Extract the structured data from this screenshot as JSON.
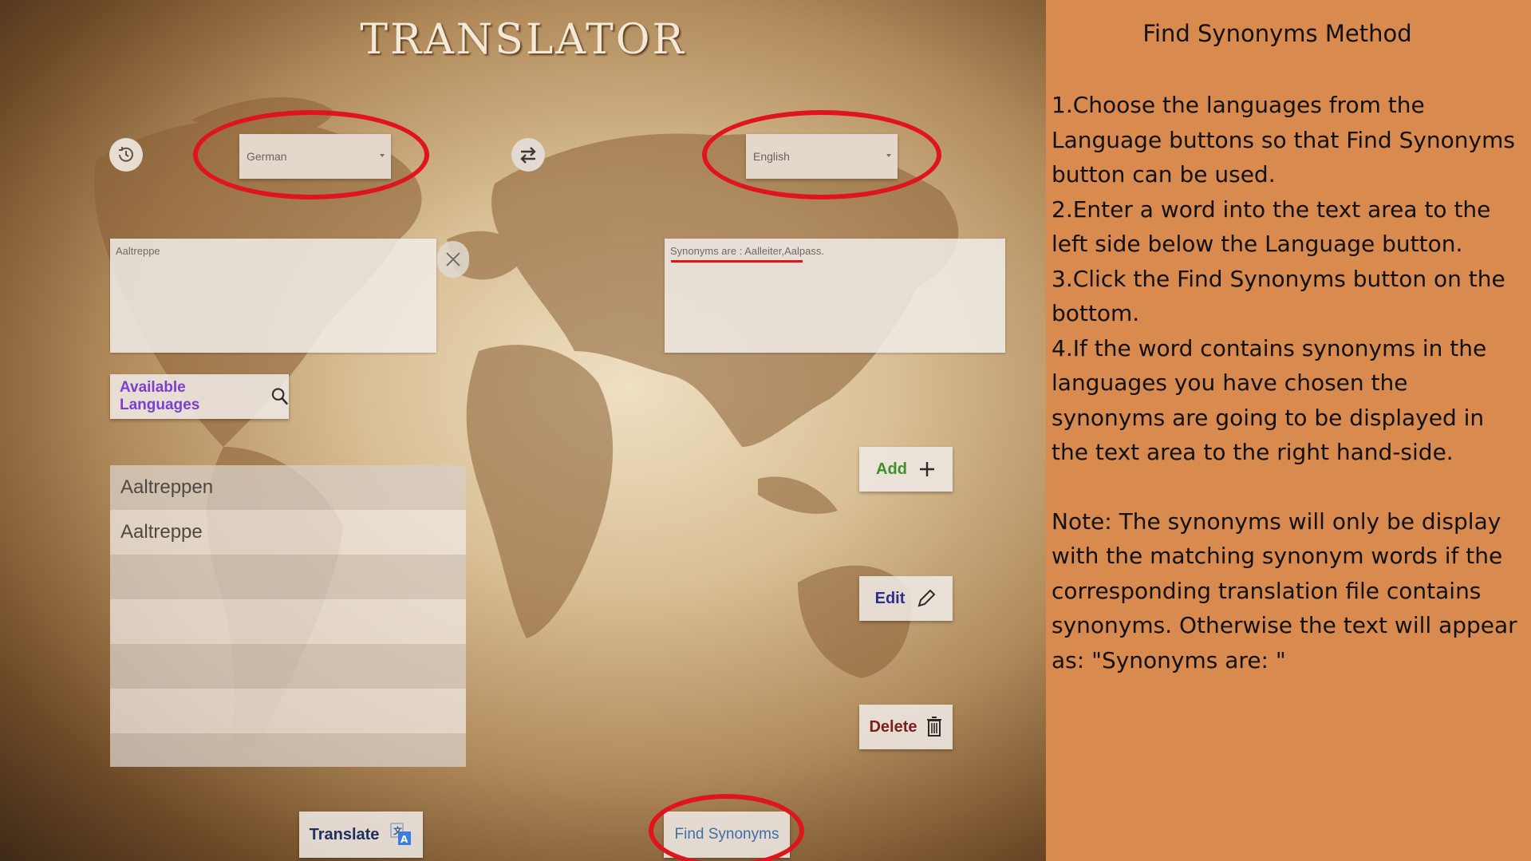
{
  "app": {
    "title": "TRANSLATOR",
    "source_language": "German",
    "target_language": "English",
    "input_text": "Aaltreppe",
    "output_text": "Synonyms are : Aalleiter,Aalpass.",
    "available_languages_label": "Available Languages",
    "word_list": [
      "Aaltreppen",
      "Aaltreppe",
      "",
      "",
      "",
      "",
      ""
    ],
    "add_label": "Add",
    "edit_label": "Edit",
    "delete_label": "Delete",
    "translate_label": "Translate",
    "find_synonyms_label": "Find Synonyms"
  },
  "panel": {
    "title": "Find Synonyms Method",
    "steps": [
      "1.Choose the languages from the Language buttons so that Find Synonyms button can be used.",
      "2.Enter a word into the text area to the left side below the Language button.",
      "3.Click the Find Synonyms button on the bottom.",
      "4.If the word contains synonyms in the languages you have chosen the synonyms are going to be displayed in the text area to the right hand-side."
    ],
    "note": "Note: The synonyms will only be display with the matching synonym words if the corresponding translation file contains synonyms. Otherwise the text will appear as: \"Synonyms are: \""
  },
  "colors": {
    "highlight": "#e0141c",
    "panel_background": "#d88a4f",
    "available_languages_text": "#7a3fd1",
    "add_text": "#3f8f2d",
    "edit_text": "#2b2f8c",
    "delete_text": "#7a1f1f",
    "translate_text": "#1f2e5c",
    "find_synonyms_text": "#3e6fa8"
  },
  "icons": [
    "history-icon",
    "swap-icon",
    "clear-icon",
    "search-icon",
    "plus-icon",
    "pencil-icon",
    "trash-icon",
    "translate-icon"
  ]
}
